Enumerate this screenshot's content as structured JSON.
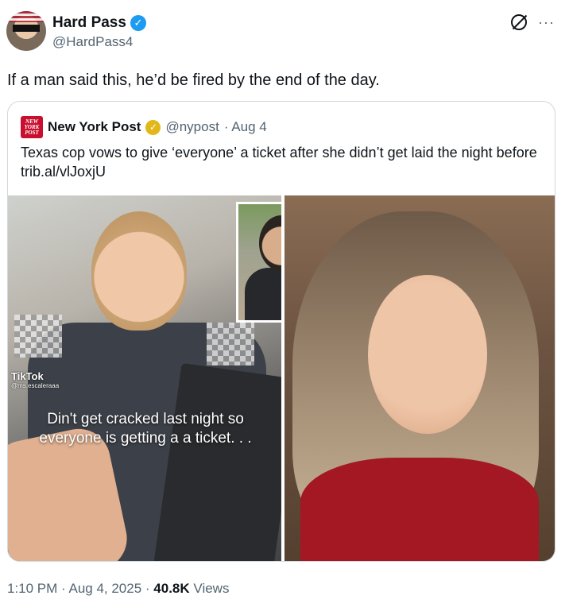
{
  "author": {
    "name": "Hard Pass",
    "handle": "@HardPass4"
  },
  "tweet": {
    "text": "If a man said this, he’d be fired by the end of the day."
  },
  "quote": {
    "logo_text": "NEW YORK POST",
    "name": "New York Post",
    "handle": "@nypost",
    "date": "· Aug 4",
    "text": "Texas cop vows to give ‘everyone’ a ticket after she didn’t get laid the night before trib.al/vlJoxjU",
    "overlay": {
      "tiktok": "TikTok",
      "tiktok_user": "@ms.escaleraaa",
      "caption": "Din't get cracked last night so everyone is getting a a ticket. . ."
    }
  },
  "meta": {
    "time": "1:10 PM · Aug 4, 2025 ·",
    "views_count": "40.8K",
    "views_label": "Views"
  },
  "colors": {
    "verified_blue": "#1d9bf0",
    "gold_check": "#e2b719",
    "secondary_text": "#536471"
  },
  "icons": [
    "verified-badge-icon",
    "grok-icon",
    "more-icon",
    "gold-verified-icon"
  ]
}
